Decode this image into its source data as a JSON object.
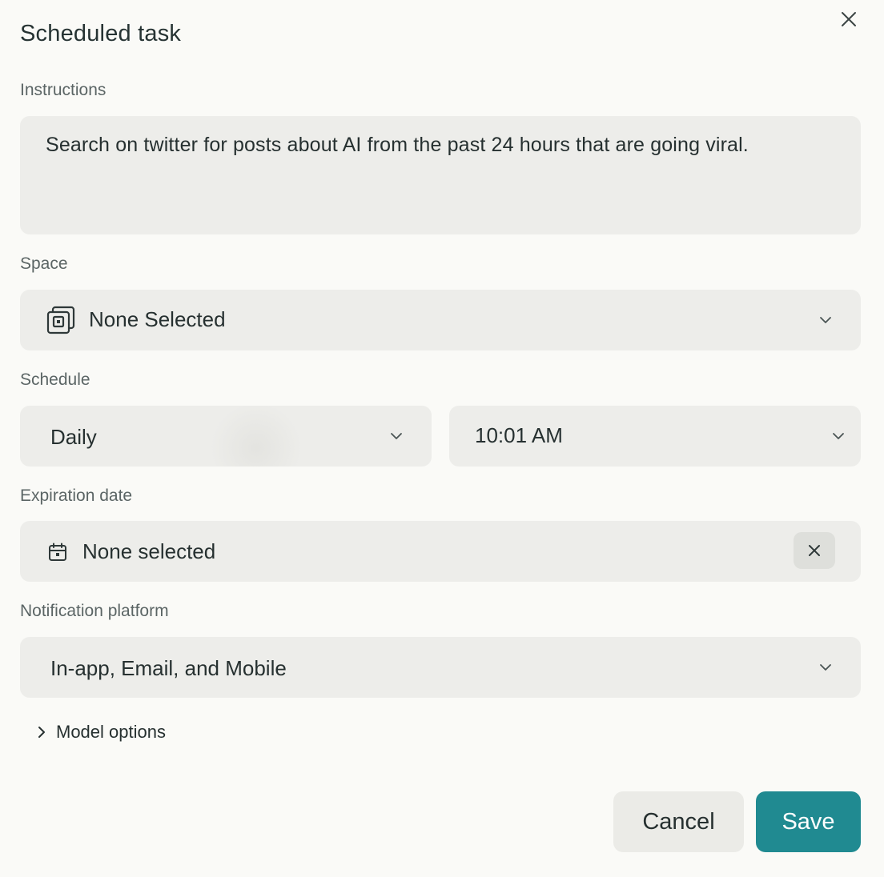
{
  "dialog": {
    "title": "Scheduled task",
    "close_icon": "close-icon"
  },
  "instructions": {
    "label": "Instructions",
    "value": "Search on twitter for posts about AI from the past 24 hours that are going viral."
  },
  "space": {
    "label": "Space",
    "value": "None Selected",
    "icon": "space-stack-icon"
  },
  "schedule": {
    "label": "Schedule",
    "frequency": "Daily",
    "time": "10:01 AM"
  },
  "expiration": {
    "label": "Expiration date",
    "value": "None selected",
    "icon": "calendar-icon"
  },
  "notification": {
    "label": "Notification platform",
    "value": "In-app, Email, and Mobile"
  },
  "model_options": {
    "label": "Model options"
  },
  "actions": {
    "cancel_label": "Cancel",
    "save_label": "Save"
  },
  "colors": {
    "accent": "#208a91",
    "field_bg": "#ededea",
    "page_bg": "#fafaf7"
  }
}
